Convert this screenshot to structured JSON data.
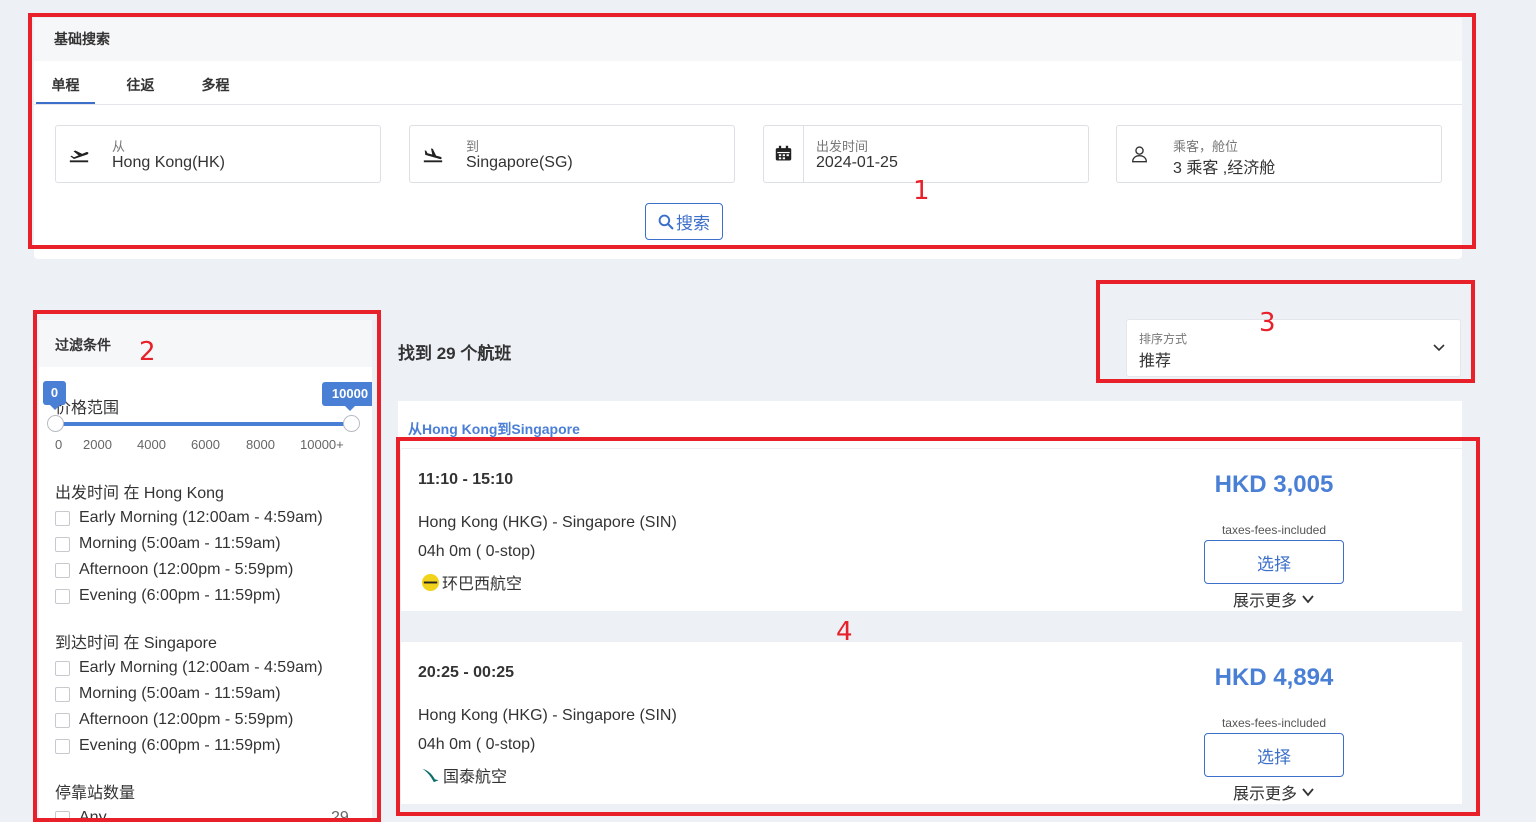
{
  "search": {
    "header": "基础搜索",
    "tabs": [
      "单程",
      "往返",
      "多程"
    ],
    "from": {
      "label": "从",
      "value": "Hong Kong(HK)"
    },
    "to": {
      "label": "到",
      "value": "Singapore(SG)"
    },
    "date": {
      "label": "出发时间",
      "value": "2024-01-25"
    },
    "passengers": {
      "label": "乘客，舱位",
      "value": "3 乘客 ,经济舱"
    },
    "button": "搜索"
  },
  "filter": {
    "header": "过滤条件",
    "price": {
      "label": "价格范围",
      "min_label": "0",
      "max_label": "10000",
      "range": [
        0,
        10000
      ],
      "ticks": [
        "0",
        "2000",
        "4000",
        "6000",
        "8000",
        "10000+"
      ]
    },
    "departure": {
      "label": "出发时间 在 Hong Kong",
      "options": [
        "Early Morning (12:00am - 4:59am)",
        "Morning (5:00am - 11:59am)",
        "Afternoon (12:00pm - 5:59pm)",
        "Evening (6:00pm - 11:59pm)"
      ]
    },
    "arrival": {
      "label": "到达时间 在 Singapore",
      "options": [
        "Early Morning (12:00am - 4:59am)",
        "Morning (5:00am - 11:59am)",
        "Afternoon (12:00pm - 5:59pm)",
        "Evening (6:00pm - 11:59pm)"
      ]
    },
    "stops": {
      "label": "停靠站数量",
      "option": "Any",
      "count": "29"
    }
  },
  "results": {
    "count": "找到 29 个航班",
    "sort": {
      "label": "排序方式",
      "value": "推荐"
    },
    "route_title": "从Hong Kong到Singapore",
    "flights": [
      {
        "time": "11:10 - 15:10",
        "route": "Hong Kong (HKG) - Singapore (SIN)",
        "duration": "04h 0m ( 0-stop)",
        "airline": "环巴西航空",
        "price": "HKD 3,005",
        "tax": "taxes-fees-included",
        "select": "选择",
        "more": "展示更多"
      },
      {
        "time": "20:25 - 00:25",
        "route": "Hong Kong (HKG) - Singapore (SIN)",
        "duration": "04h 0m ( 0-stop)",
        "airline": "国泰航空",
        "price": "HKD 4,894",
        "tax": "taxes-fees-included",
        "select": "选择",
        "more": "展示更多"
      }
    ]
  },
  "annotations": [
    "1",
    "2",
    "3",
    "4"
  ],
  "colors": {
    "accent": "#4a7fd6",
    "annotation": "#e8202a"
  }
}
